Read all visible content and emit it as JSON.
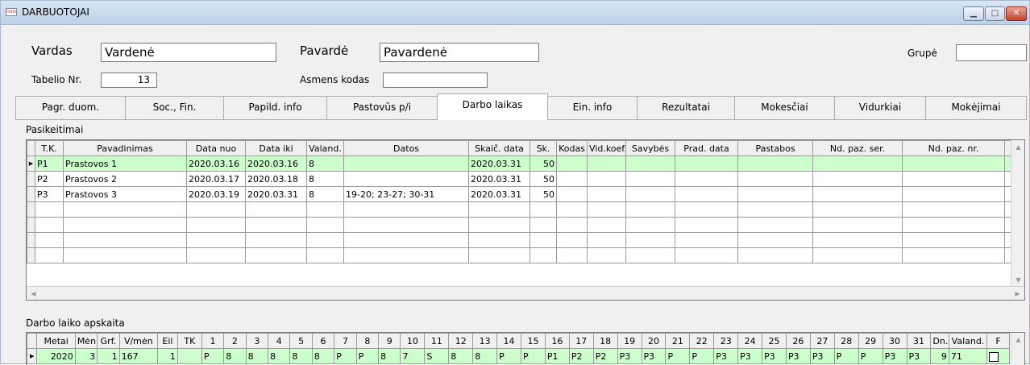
{
  "window": {
    "title": "DARBUOTOJAI",
    "icon_text": "none"
  },
  "form": {
    "vardas_label": "Vardas",
    "vardas_value": "Vardenė",
    "pavarde_label": "Pavardė",
    "pavarde_value": "Pavardenė",
    "grupe_label": "Grupė",
    "grupe_value": "",
    "tabelio_label": "Tabelio Nr.",
    "tabelio_value": "13",
    "asmens_label": "Asmens kodas",
    "asmens_value": ""
  },
  "tabs": [
    "Pagr. duom.",
    "Soc., Fin.",
    "Papild. info",
    "Pastovūs p/i",
    "Darbo laikas",
    "Ein. info",
    "Rezultatai",
    "Mokesčiai",
    "Vidurkiai",
    "Mokėjimai"
  ],
  "active_tab": "Darbo laikas",
  "pasikeitimai": {
    "label": "Pasikeitimai",
    "columns": [
      "T.K.",
      "Pavadinimas",
      "Data nuo",
      "Data iki",
      "Valand.",
      "Datos",
      "Skaič. data",
      "Sk.",
      "Kodas",
      "Vid.koef.",
      "Savybės",
      "Prad. data",
      "Pastabos",
      "Nd. paz. ser.",
      "Nd. paz. nr."
    ],
    "rows": [
      [
        "P1",
        "Prastovos 1",
        "2020.03.16",
        "2020.03.16",
        "8",
        "",
        "2020.03.31",
        "50",
        "",
        "",
        "",
        "",
        "",
        "",
        ""
      ],
      [
        "P2",
        "Prastovos 2",
        "2020.03.17",
        "2020.03.18",
        "8",
        "",
        "2020.03.31",
        "50",
        "",
        "",
        "",
        "",
        "",
        "",
        ""
      ],
      [
        "P3",
        "Prastovos 3",
        "2020.03.19",
        "2020.03.31",
        "8",
        "19-20; 23-27; 30-31",
        "2020.03.31",
        "50",
        "",
        "",
        "",
        "",
        "",
        "",
        ""
      ]
    ]
  },
  "apskaita": {
    "label": "Darbo laiko apskaita",
    "columns": [
      "Metai",
      "Mėn",
      "Grf.",
      "V/mėn",
      "Eil",
      "TK",
      "1",
      "2",
      "3",
      "4",
      "5",
      "6",
      "7",
      "8",
      "9",
      "10",
      "11",
      "12",
      "13",
      "14",
      "15",
      "16",
      "17",
      "18",
      "19",
      "20",
      "21",
      "22",
      "23",
      "24",
      "25",
      "26",
      "27",
      "28",
      "29",
      "30",
      "31",
      "Dn.",
      "Valand.",
      "F"
    ],
    "row": [
      "2020",
      "3",
      "1",
      "167",
      "1",
      "",
      "P",
      "8",
      "8",
      "8",
      "8",
      "8",
      "P",
      "P",
      "8",
      "7",
      "S",
      "8",
      "8",
      "P",
      "P",
      "P1",
      "P2",
      "P2",
      "P3",
      "P3",
      "P",
      "P",
      "P3",
      "P3",
      "P3",
      "P3",
      "P3",
      "P",
      "P",
      "P3",
      "P3",
      "9",
      "71",
      ""
    ]
  }
}
